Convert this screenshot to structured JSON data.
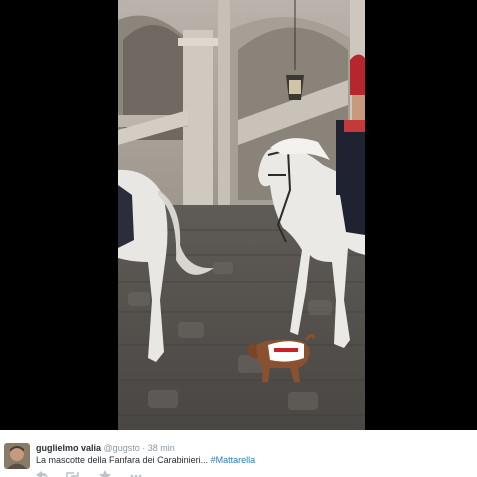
{
  "tweet": {
    "display_name": "guglielmo valia",
    "handle": "@gugsto",
    "separator": "·",
    "timestamp": "38 min",
    "text": "La mascotte della Fanfara dei Carabinieri... ",
    "hashtag": "#Mattarella"
  },
  "colors": {
    "name": "#292f33",
    "meta": "#8899a6",
    "hashtag": "#2b7bb9",
    "background": "#000000"
  },
  "icons": [
    "reply-icon",
    "retweet-icon",
    "favorite-icon",
    "more-icon"
  ]
}
